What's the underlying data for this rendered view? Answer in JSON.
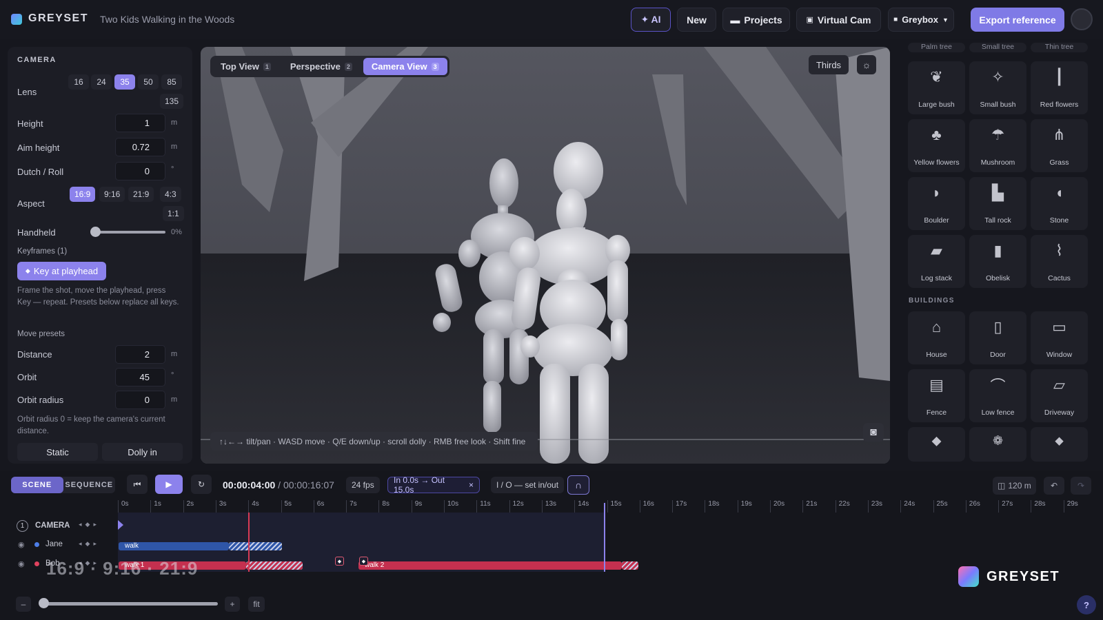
{
  "header": {
    "brand": "GREYSET",
    "scene_title": "Two Kids Walking in the Woods",
    "ai_label": "✦ AI",
    "new_label": "New",
    "projects_label": "Projects",
    "virtual_cam_label": "Virtual Cam",
    "greybox_label": "Greybox",
    "export_label": "Export reference"
  },
  "camera_panel": {
    "section_title": "CAMERA",
    "lens_label": "Lens",
    "lens_options": [
      "16",
      "24",
      "35",
      "50",
      "85",
      "135"
    ],
    "lens_selected": "35",
    "height_label": "Height",
    "height_value": "1",
    "height_unit": "m",
    "aim_label": "Aim height",
    "aim_value": "0.72",
    "aim_unit": "m",
    "dutch_label": "Dutch / Roll",
    "dutch_value": "0",
    "dutch_unit": "°",
    "aspect_label": "Aspect",
    "aspect_options": [
      "16:9",
      "9:16",
      "21:9",
      "4:3",
      "1:1"
    ],
    "aspect_selected": "16:9",
    "handheld_label": "Handheld",
    "handheld_value": "0%",
    "handheld_level": 0,
    "keyframes_label": "Keyframes (1)",
    "key_button": "Key at playhead",
    "key_help": "Frame the shot, move the playhead, press Key — repeat. Presets below replace all keys.",
    "move_presets_label": "Move presets",
    "distance_label": "Distance",
    "distance_value": "2",
    "distance_unit": "m",
    "orbit_label": "Orbit",
    "orbit_value": "45",
    "orbit_unit": "°",
    "orbit_radius_label": "Orbit radius",
    "orbit_radius_value": "0",
    "orbit_radius_unit": "m",
    "orbit_help": "Orbit radius 0 = keep the camera's current distance.",
    "static_label": "Static",
    "dolly_label": "Dolly in"
  },
  "viewport": {
    "tabs": [
      {
        "label": "Top View",
        "key": "1"
      },
      {
        "label": "Perspective",
        "key": "2"
      },
      {
        "label": "Camera View",
        "key": "3"
      }
    ],
    "active_tab": "Camera View",
    "thirds_label": "Thirds",
    "hint": "↑↓←→ tilt/pan · WASD move · Q/E down/up · scroll dolly · RMB free look · Shift fine"
  },
  "library": {
    "partial_top": [
      "Palm tree",
      "Small tree",
      "Thin tree"
    ],
    "nature_items": [
      "Large bush",
      "Small bush",
      "Red flowers",
      "Yellow flowers",
      "Mushroom",
      "Grass",
      "Boulder",
      "Tall rock",
      "Stone",
      "Log stack",
      "Obelisk",
      "Cactus"
    ],
    "buildings_title": "BUILDINGS",
    "building_items": [
      "House",
      "Door",
      "Window",
      "Fence",
      "Low fence",
      "Driveway"
    ]
  },
  "timeline": {
    "mode_scene": "SCENE",
    "mode_sequence": "SEQUENCE",
    "current_time": "00:00:04:00",
    "total_time": "00:00:16:07",
    "separator": "/",
    "fps": "24 fps",
    "in_out": "In 0.0s → Out 15.0s",
    "io_hint": "I / O — set in/out",
    "distance": "120 m",
    "ticks": [
      "0s",
      "1s",
      "2s",
      "3s",
      "4s",
      "5s",
      "6s",
      "7s",
      "8s",
      "9s",
      "10s",
      "11s",
      "12s",
      "13s",
      "14s",
      "15s",
      "16s",
      "17s",
      "18s",
      "19s",
      "20s",
      "21s",
      "22s",
      "23s",
      "24s",
      "25s",
      "26s",
      "27s",
      "28s",
      "29s"
    ],
    "tracks": [
      {
        "name": "CAMERA",
        "index": "1"
      },
      {
        "name": "Jane",
        "color": "#4d7ee8"
      },
      {
        "name": "Bob",
        "color": "#e0425e"
      }
    ],
    "clips": {
      "jane_walk": "walk",
      "bob_walk1": "walk 1",
      "bob_walk2": "walk 2"
    },
    "playhead_seconds": 4.0,
    "out_seconds": 15.0,
    "aspect_overlay": "16:9 · 9:16 · 21:9",
    "zoom_minus": "–",
    "zoom_plus": "+",
    "zoom_fit": "fit"
  },
  "watermark": {
    "text": "GREYSET"
  },
  "colors": {
    "accent": "#8c82ec",
    "jane": "#2f56a8",
    "bob": "#c4304f"
  }
}
